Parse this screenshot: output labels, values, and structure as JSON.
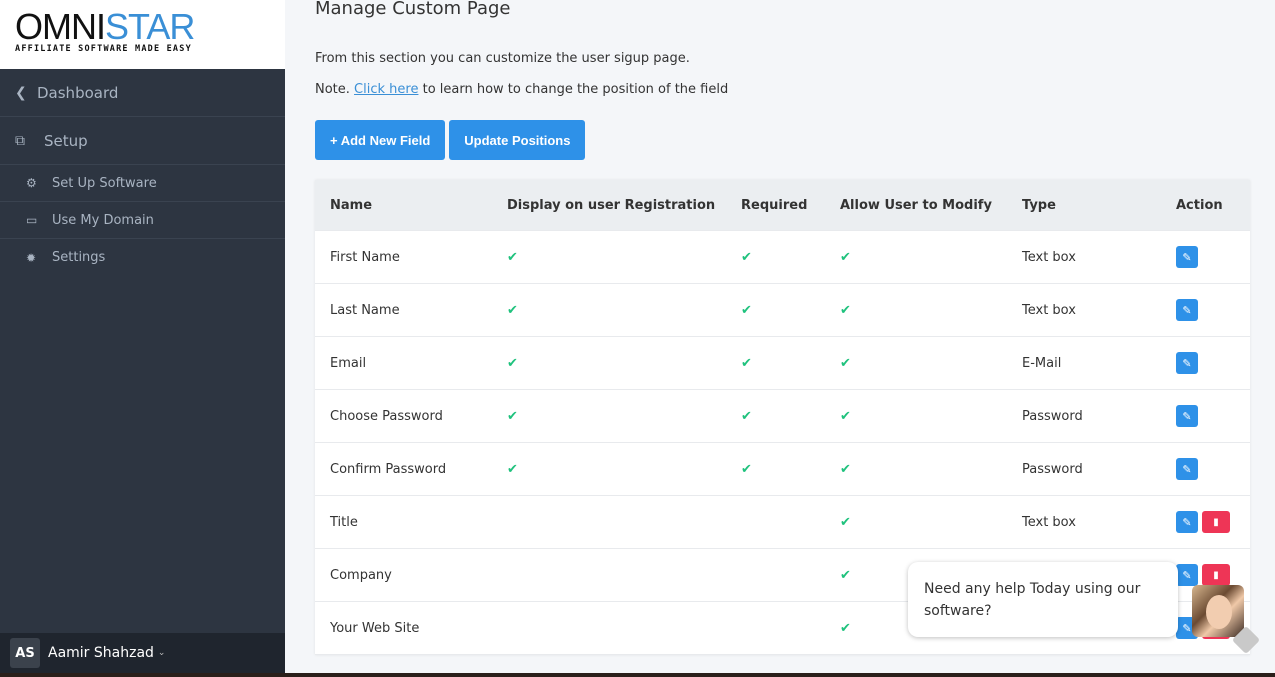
{
  "brand": {
    "name_a": "OMNI",
    "name_b": "STAR",
    "tagline": "AFFILIATE SOFTWARE MADE EASY",
    "accent": "#3a8fd6"
  },
  "sidebar": {
    "back": {
      "icon": "chevron-left-icon",
      "label": "Dashboard"
    },
    "section": {
      "icon": "cubes-icon",
      "label": "Setup"
    },
    "items": [
      {
        "icon": "gears-icon",
        "label": "Set Up Software"
      },
      {
        "icon": "desktop-icon",
        "label": "Use My Domain"
      },
      {
        "icon": "gear-icon",
        "label": "Settings"
      }
    ],
    "user": {
      "initials": "AS",
      "name": "Aamir Shahzad"
    }
  },
  "main": {
    "title": "Manage Custom Page",
    "description": "From this section you can customize the user sigup page.",
    "note_prefix": "Note.",
    "note_link": "Click here",
    "note_suffix": "to learn how to change the position of the field",
    "add_button": "+ Add New Field",
    "update_button": "Update Positions"
  },
  "table": {
    "headers": [
      "Name",
      "Display on user Registration",
      "Required",
      "Allow User to Modify",
      "Type",
      "Action"
    ],
    "rows": [
      {
        "name": "First Name",
        "display": true,
        "required": true,
        "modify": true,
        "type": "Text box",
        "deletable": false
      },
      {
        "name": "Last Name",
        "display": true,
        "required": true,
        "modify": true,
        "type": "Text box",
        "deletable": false
      },
      {
        "name": "Email",
        "display": true,
        "required": true,
        "modify": true,
        "type": "E-Mail",
        "deletable": false
      },
      {
        "name": "Choose Password",
        "display": true,
        "required": true,
        "modify": true,
        "type": "Password",
        "deletable": false
      },
      {
        "name": "Confirm Password",
        "display": true,
        "required": true,
        "modify": true,
        "type": "Password",
        "deletable": false
      },
      {
        "name": "Title",
        "display": false,
        "required": false,
        "modify": true,
        "type": "Text box",
        "deletable": true
      },
      {
        "name": "Company",
        "display": false,
        "required": false,
        "modify": true,
        "type": "",
        "deletable": true
      },
      {
        "name": "Your Web Site",
        "display": false,
        "required": false,
        "modify": true,
        "type": "",
        "deletable": true
      }
    ],
    "check_glyph": "✔",
    "edit_glyph": "✎",
    "delete_glyph": "🗑"
  },
  "chat": {
    "message": "Need any help Today using our software?"
  }
}
